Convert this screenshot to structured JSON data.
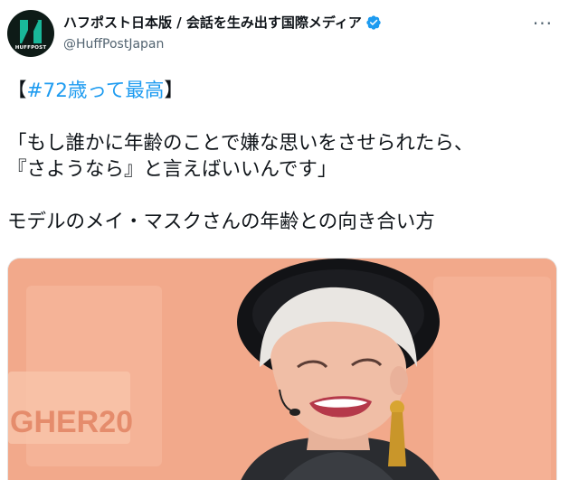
{
  "account": {
    "display_name": "ハフポスト日本版 / 会話を生み出す国際メディア",
    "handle": "@HuffPostJapan",
    "avatar_text": "HUFFPOST",
    "verified": true
  },
  "tweet": {
    "hashtag_open": "【",
    "hashtag": "#72歳って最高",
    "hashtag_close": "】",
    "quote_line1": "「もし誰かに年齢のことで嫌な思いをさせられたら、",
    "quote_line2": "『さようなら』と言えばいいんです」",
    "caption": "モデルのメイ・マスクさんの年齢との向き合い方"
  },
  "media": {
    "backdrop_text": "GHER20"
  },
  "colors": {
    "link": "#1d9bf0",
    "verified": "#1d9bf0",
    "secondary_text": "#536471",
    "brand": "#19b89a"
  }
}
